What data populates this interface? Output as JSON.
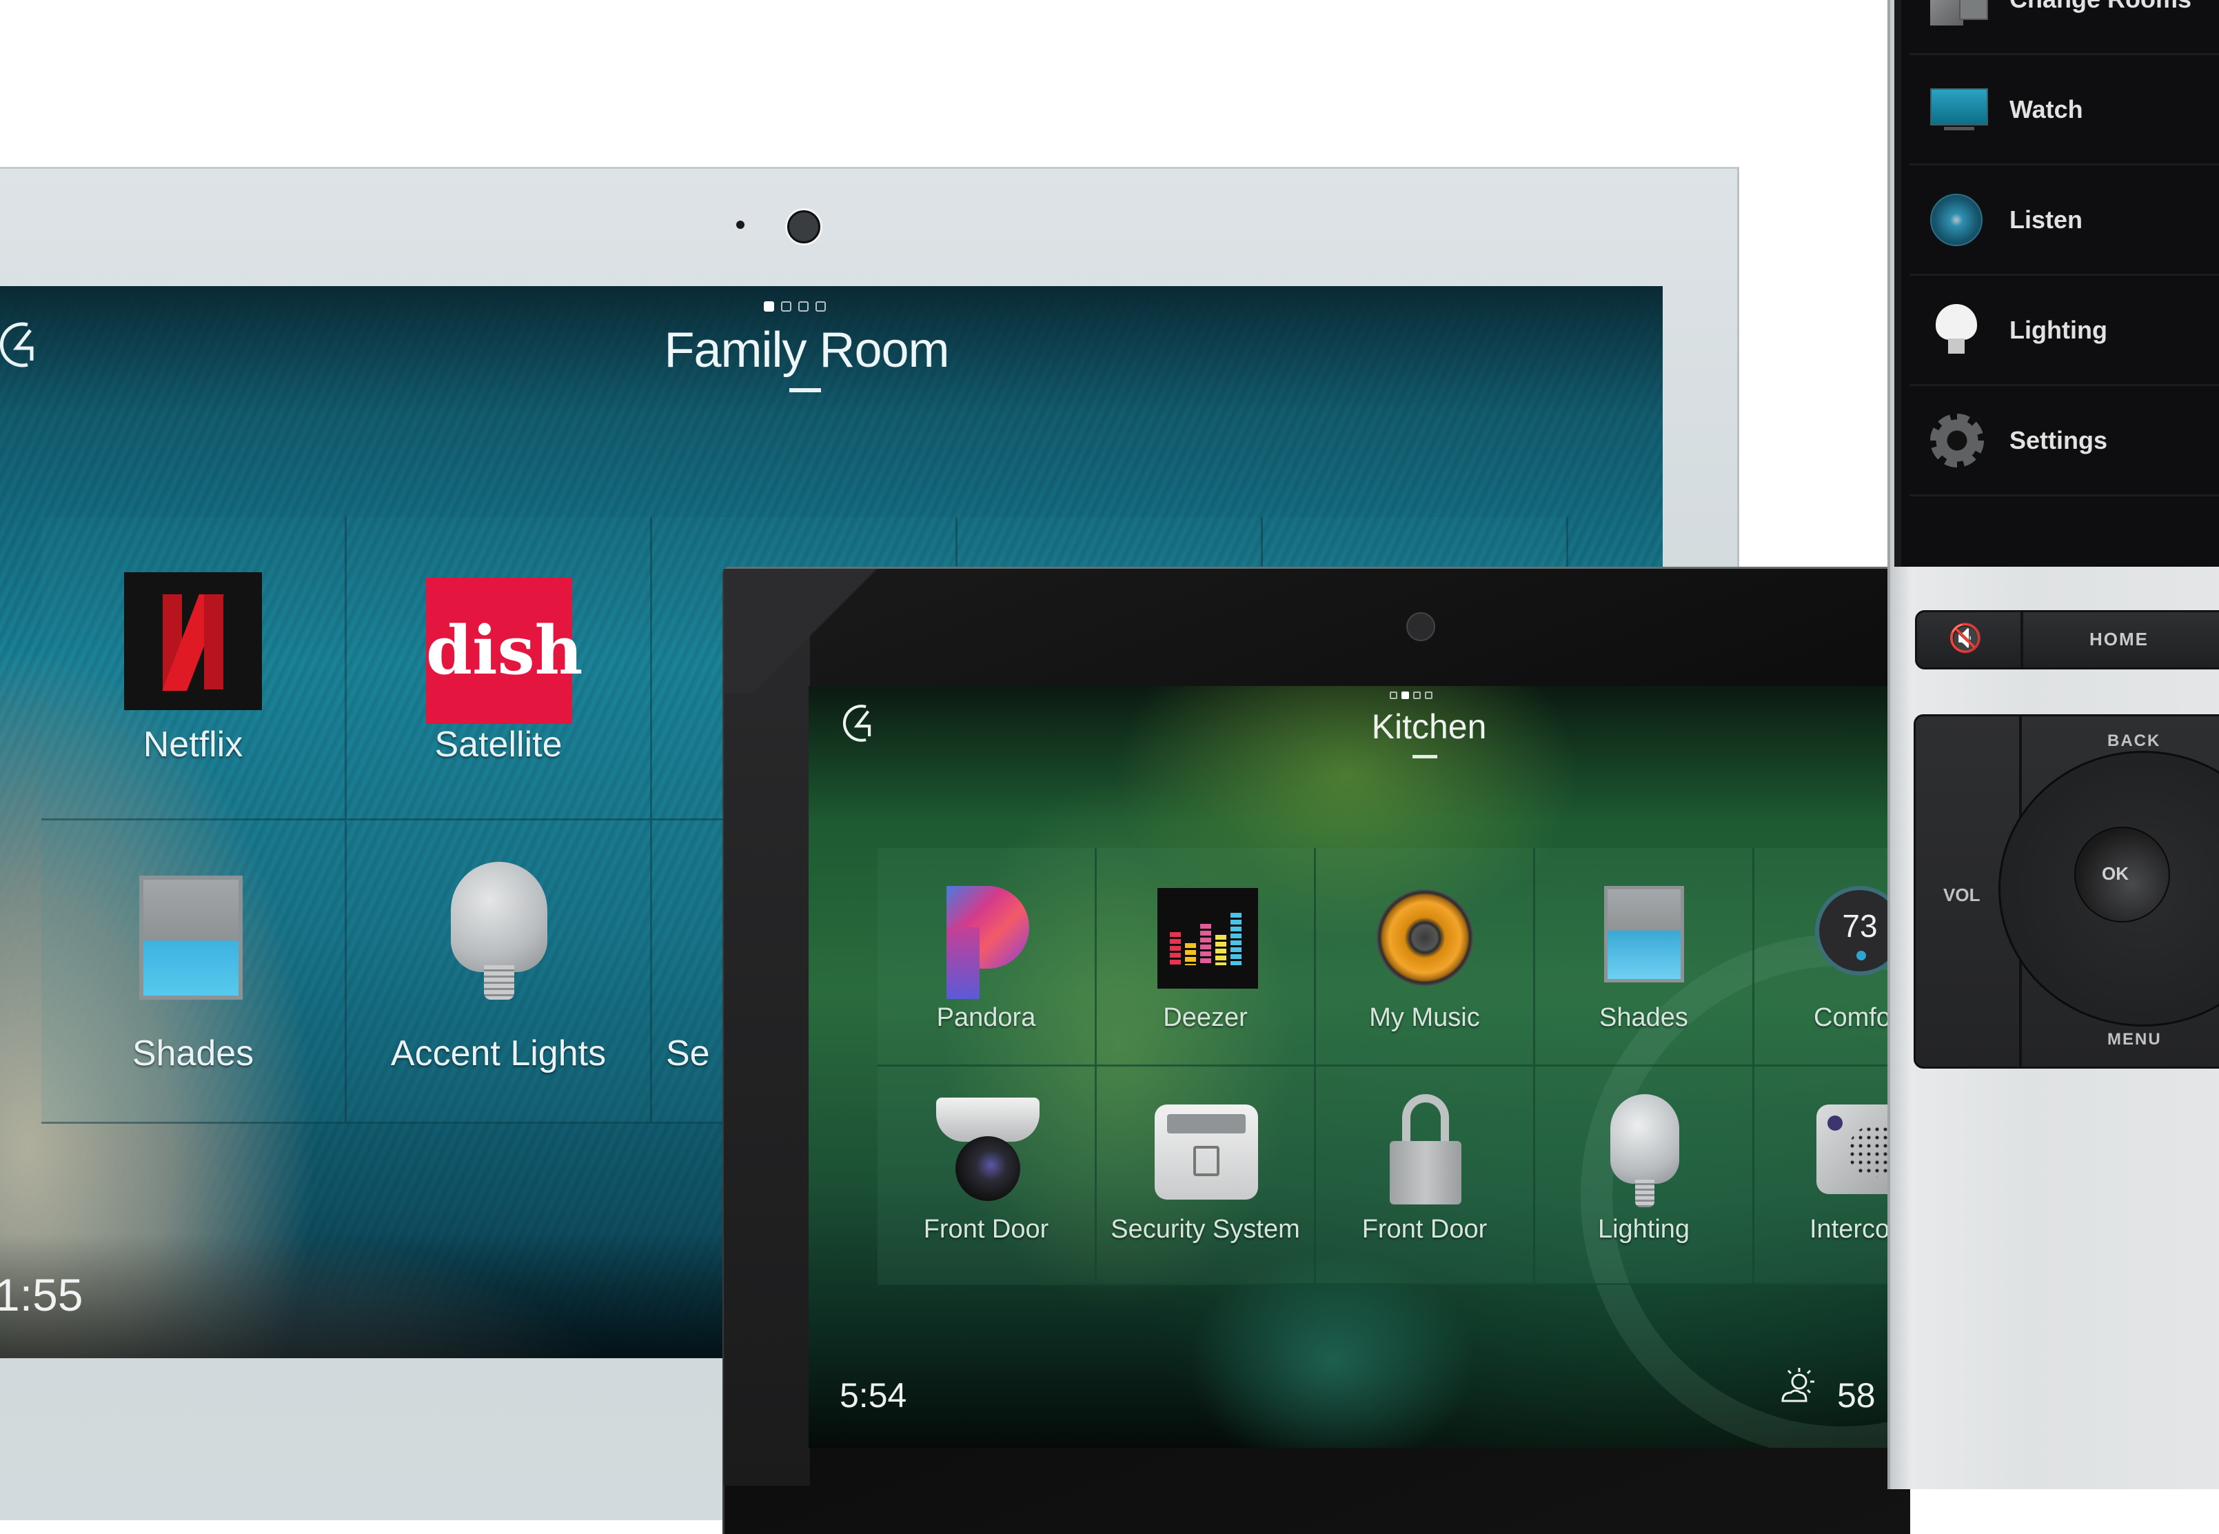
{
  "family_room_panel": {
    "title": "Family Room",
    "page_indicator": {
      "count": 4,
      "active_index": 0
    },
    "logo_icon": "control4-logo-icon",
    "time": "1:55",
    "tiles": [
      {
        "label": "Netflix",
        "icon": "netflix-icon"
      },
      {
        "label": "Satellite",
        "icon": "dish-icon",
        "icon_text": "dish"
      },
      {
        "label": "Shades",
        "icon": "shades-icon"
      },
      {
        "label": "Accent Lights",
        "icon": "light-bulb-icon"
      },
      {
        "label": "Se",
        "icon": "none"
      }
    ]
  },
  "kitchen_panel": {
    "title": "Kitchen",
    "page_indicator": {
      "count": 4,
      "active_index": 1
    },
    "logo_icon": "control4-logo-icon",
    "time": "5:54",
    "weather": {
      "icon": "partly-sunny-icon",
      "temperature": "58"
    },
    "tiles_row1": [
      {
        "label": "Pandora",
        "icon": "pandora-icon"
      },
      {
        "label": "Deezer",
        "icon": "deezer-icon"
      },
      {
        "label": "My Music",
        "icon": "speaker-icon"
      },
      {
        "label": "Shades",
        "icon": "shades-icon"
      },
      {
        "label": "Comfo",
        "icon": "thermostat-icon",
        "value": "73"
      }
    ],
    "tiles_row2": [
      {
        "label": "Front Door",
        "icon": "security-camera-icon"
      },
      {
        "label": "Security System",
        "icon": "security-panel-icon"
      },
      {
        "label": "Front Door",
        "icon": "padlock-icon"
      },
      {
        "label": "Lighting",
        "icon": "light-bulb-icon"
      },
      {
        "label": "Interco",
        "icon": "intercom-icon"
      }
    ]
  },
  "remote": {
    "menu": [
      {
        "label": "Change Rooms",
        "icon": "change-rooms-icon"
      },
      {
        "label": "Watch",
        "icon": "tv-icon"
      },
      {
        "label": "Listen",
        "icon": "speaker-icon"
      },
      {
        "label": "Lighting",
        "icon": "light-bulb-icon"
      },
      {
        "label": "Settings",
        "icon": "gear-icon"
      }
    ],
    "buttons": {
      "mute": "🔇",
      "home": "HOME",
      "back": "BACK",
      "ok": "OK",
      "menu": "MENU",
      "vol": "VOL"
    }
  }
}
